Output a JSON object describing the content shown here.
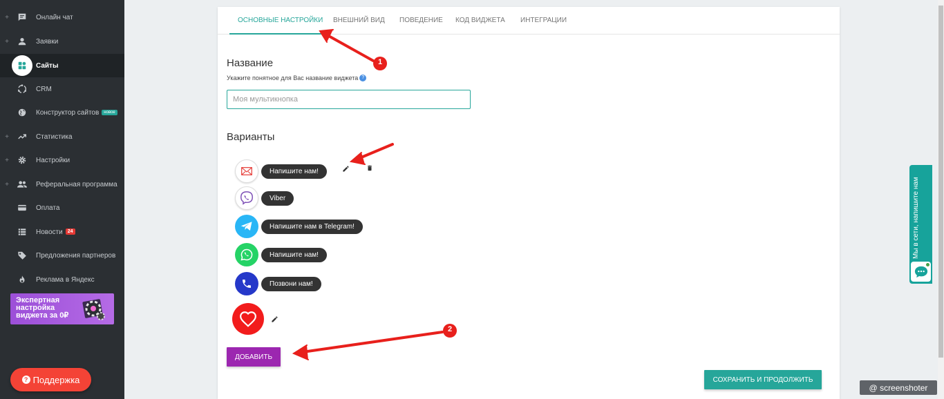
{
  "sidebar": {
    "items": [
      {
        "label": "Онлайн чат",
        "icon": "chat-icon",
        "expandable": true
      },
      {
        "label": "Заявки",
        "icon": "person-icon",
        "expandable": true
      },
      {
        "label": "Сайты",
        "icon": "sites-icon",
        "active": true
      },
      {
        "label": "CRM",
        "icon": "crm-icon"
      },
      {
        "label": "Конструктор сайтов",
        "icon": "globe-icon",
        "badge": "новое"
      },
      {
        "label": "Статистика",
        "icon": "trending-icon",
        "expandable": true
      },
      {
        "label": "Настройки",
        "icon": "gear-icon",
        "expandable": true
      },
      {
        "label": "Реферальная программа",
        "icon": "people-icon",
        "expandable": true
      },
      {
        "label": "Оплата",
        "icon": "card-icon"
      },
      {
        "label": "Новости",
        "icon": "news-icon",
        "count": "24"
      },
      {
        "label": "Предложения партнеров",
        "icon": "tag-icon"
      },
      {
        "label": "Реклама в Яндекс",
        "icon": "fire-icon"
      }
    ],
    "plus_symbol": "+",
    "promo": {
      "line1": "Экспертная",
      "line2": "настройка",
      "line3": "виджета за 0₽"
    },
    "support": {
      "label": "Поддержка",
      "q": "?"
    }
  },
  "tabs": [
    "ОСНОВНЫЕ НАСТРОЙКИ",
    "ВНЕШНИЙ ВИД",
    "ПОВЕДЕНИЕ",
    "КОД ВИДЖЕТА",
    "ИНТЕГРАЦИИ"
  ],
  "form": {
    "name_title": "Название",
    "name_helper": "Укажите понятное для Вас название виджета",
    "help_icon": "?",
    "name_placeholder": "Моя мультикнопка",
    "variants_title": "Варианты",
    "variants": [
      {
        "label": "Напишите нам!",
        "icon": "mail-icon",
        "color": "#ffffff"
      },
      {
        "label": "Viber",
        "icon": "viber-icon",
        "color": "#ffffff"
      },
      {
        "label": "Напишите нам в Telegram!",
        "icon": "telegram-icon",
        "color": "#29b6f6"
      },
      {
        "label": "Напишите нам!",
        "icon": "whatsapp-icon",
        "color": "#25d366"
      },
      {
        "label": "Позвони нам!",
        "icon": "phone-icon",
        "color": "#2538c9"
      }
    ],
    "main_button_color": "#f21c1c",
    "add_label": "ДОБАВИТЬ",
    "save_label": "СОХРАНИТЬ И ПРОДОЛЖИТЬ"
  },
  "side_widget": {
    "text": "Мы в сети, напишите нам"
  },
  "annotations": {
    "marker1": "1",
    "marker2": "2"
  },
  "watermark": "@ screenshoter",
  "colors": {
    "accent": "#26a69a",
    "add": "#9c27b0",
    "annotation": "#e8201c",
    "sidebar": "#2b2f33"
  }
}
